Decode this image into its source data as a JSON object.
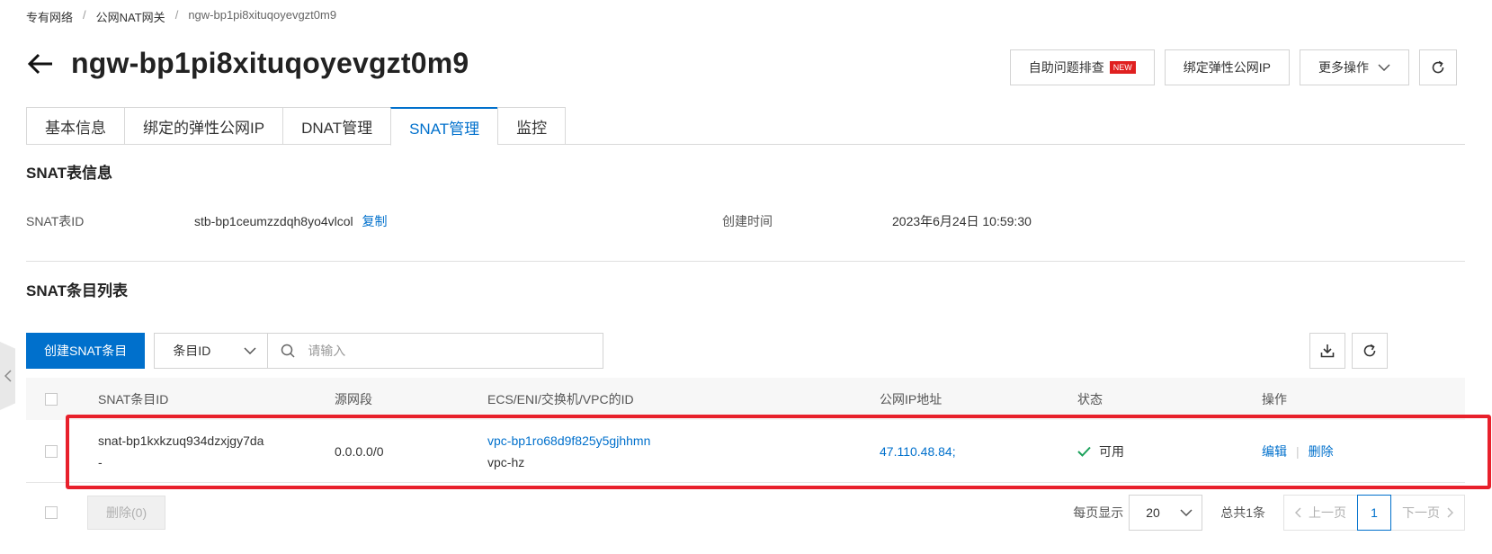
{
  "breadcrumb": {
    "items": [
      "专有网络",
      "公网NAT网关",
      "ngw-bp1pi8xituqoyevgzt0m9"
    ],
    "sep": "/"
  },
  "header": {
    "title": "ngw-bp1pi8xituqoyevgzt0m9",
    "actions": {
      "troubleshoot": "自助问题排查",
      "new_badge": "NEW",
      "bind_eip": "绑定弹性公网IP",
      "more": "更多操作"
    }
  },
  "tabs": [
    {
      "label": "基本信息"
    },
    {
      "label": "绑定的弹性公网IP"
    },
    {
      "label": "DNAT管理"
    },
    {
      "label": "SNAT管理",
      "active": true
    },
    {
      "label": "监控"
    }
  ],
  "snat_info": {
    "section_title": "SNAT表信息",
    "id_label": "SNAT表ID",
    "id_value": "stb-bp1ceumzzdqh8yo4vlcol",
    "copy": "复制",
    "created_label": "创建时间",
    "created_value": "2023年6月24日 10:59:30"
  },
  "snat_list": {
    "section_title": "SNAT条目列表",
    "create_button": "创建SNAT条目",
    "filter_select": "条目ID",
    "search_placeholder": "请输入",
    "columns": [
      "SNAT条目ID",
      "源网段",
      "ECS/ENI/交换机/VPC的ID",
      "公网IP地址",
      "状态",
      "操作"
    ],
    "rows": [
      {
        "id": "snat-bp1kxkzuq934dzxjgy7da",
        "name": "-",
        "source_cidr": "0.0.0.0/0",
        "resource_id": "vpc-bp1ro68d9f825y5gjhhmn",
        "resource_name": "vpc-hz",
        "public_ip": "47.110.48.84;",
        "status": "可用",
        "op_edit": "编辑",
        "op_delete": "删除"
      }
    ],
    "bulk_delete": "删除(0)"
  },
  "pagination": {
    "per_page_label": "每页显示",
    "per_page": "20",
    "total": "总共1条",
    "prev": "上一页",
    "current": "1",
    "next": "下一页"
  },
  "colors": {
    "primary": "#0070cc",
    "highlight": "#e8202b",
    "success": "#1aa15a"
  }
}
